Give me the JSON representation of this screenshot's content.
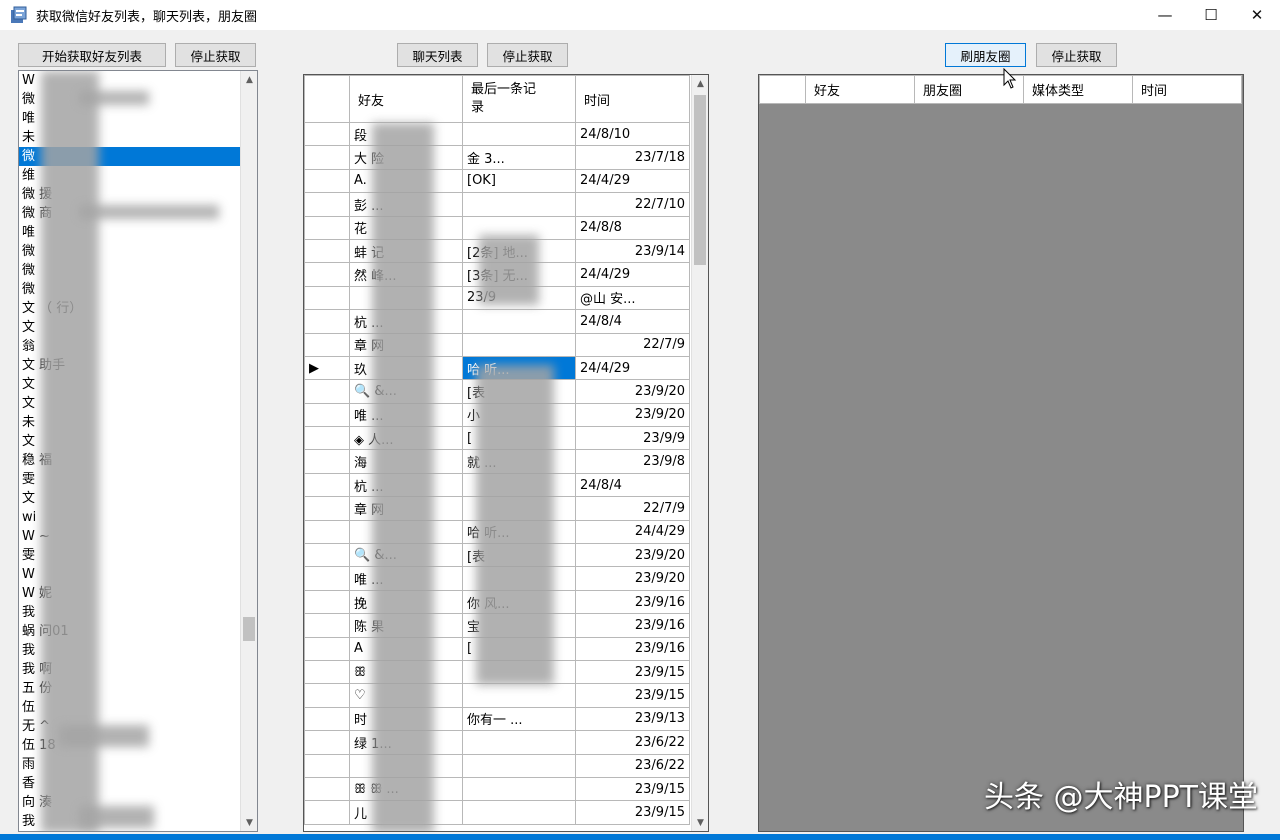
{
  "window": {
    "title": "获取微信好友列表，聊天列表，朋友圈",
    "minimize": "—",
    "maximize": "☐",
    "close": "✕"
  },
  "toolbar": {
    "start_friends": "开始获取好友列表",
    "stop_friends": "停止获取",
    "chat_list": "聊天列表",
    "stop_chat": "停止获取",
    "refresh_moments": "刷朋友圈",
    "stop_moments": "停止获取"
  },
  "friends": [
    "W",
    "微",
    "唯",
    "未",
    "微",
    "维",
    "微 援",
    "微 商",
    "唯",
    "微",
    "微",
    "微",
    "文 （ 行）",
    "文",
    "翁",
    "文 助手",
    "文",
    "文",
    "未",
    "文",
    "稳 福",
    "雯",
    "文",
    "wi",
    "W ~",
    "雯",
    "W",
    "W 妮",
    "我",
    "蜗 问01",
    "我",
    "我 啊",
    "五 份",
    "伍",
    "无 ^",
    "伍 18",
    "雨",
    "香",
    "向 湊",
    "我"
  ],
  "chat_table": {
    "headers": [
      "",
      "好友",
      "最后一条记\n录",
      "时间"
    ],
    "rows": [
      [
        "",
        "段",
        "",
        "24/8/10"
      ],
      [
        "",
        "大 险",
        "金 3...",
        "23/7/18"
      ],
      [
        "",
        "A.",
        "[OK]",
        "24/4/29"
      ],
      [
        "",
        "彭 ...",
        "",
        "22/7/10"
      ],
      [
        "",
        "花",
        "",
        "24/8/8"
      ],
      [
        "",
        "蚌 记",
        "[2条] 地...",
        "23/9/14"
      ],
      [
        "",
        "然 峰...",
        "[3条] 无...",
        "24/4/29"
      ],
      [
        "",
        "",
        "23/9",
        "@山 安..."
      ],
      [
        "",
        "杭 ...",
        "",
        "24/8/4"
      ],
      [
        "",
        "章 网",
        "",
        "22/7/9"
      ],
      [
        "▶",
        "玖",
        "哈 听...",
        "24/4/29"
      ],
      [
        "",
        "🔍 &...",
        "[表",
        "23/9/20"
      ],
      [
        "",
        "唯 ...",
        "小",
        "23/9/20"
      ],
      [
        "",
        "◈ 人...",
        "[",
        "23/9/9"
      ],
      [
        "",
        "海",
        "就 ...",
        "23/9/8"
      ],
      [
        "",
        "杭 ...",
        "",
        "24/8/4"
      ],
      [
        "",
        "章 网",
        "",
        "22/7/9"
      ],
      [
        "",
        "",
        "哈 听...",
        "24/4/29"
      ],
      [
        "",
        "🔍 &...",
        "[表",
        "23/9/20"
      ],
      [
        "",
        "唯 ...",
        "",
        "23/9/20"
      ],
      [
        "",
        "挽",
        "你 风...",
        "23/9/16"
      ],
      [
        "",
        "陈 果",
        "宝",
        "23/9/16"
      ],
      [
        "",
        "A",
        "[",
        "23/9/16"
      ],
      [
        "",
        "ꕥ",
        "",
        "23/9/15"
      ],
      [
        "",
        "♡",
        "",
        "23/9/15"
      ],
      [
        "",
        " 时",
        "你有一 ...",
        "23/9/13"
      ],
      [
        "",
        "绿 1...",
        "",
        "23/6/22"
      ],
      [
        "",
        "",
        "",
        "23/6/22"
      ],
      [
        "",
        "ꕥ ꕥ ...",
        "",
        "23/9/15"
      ],
      [
        "",
        "儿",
        "",
        "23/9/15"
      ]
    ]
  },
  "moments_table": {
    "headers": [
      "",
      "好友",
      "朋友圈",
      "媒体类型",
      "时间"
    ]
  },
  "watermark": "头条 @大神PPT课堂",
  "colors": {
    "selection": "#0078d7",
    "empty_area": "#8a8a8a"
  }
}
